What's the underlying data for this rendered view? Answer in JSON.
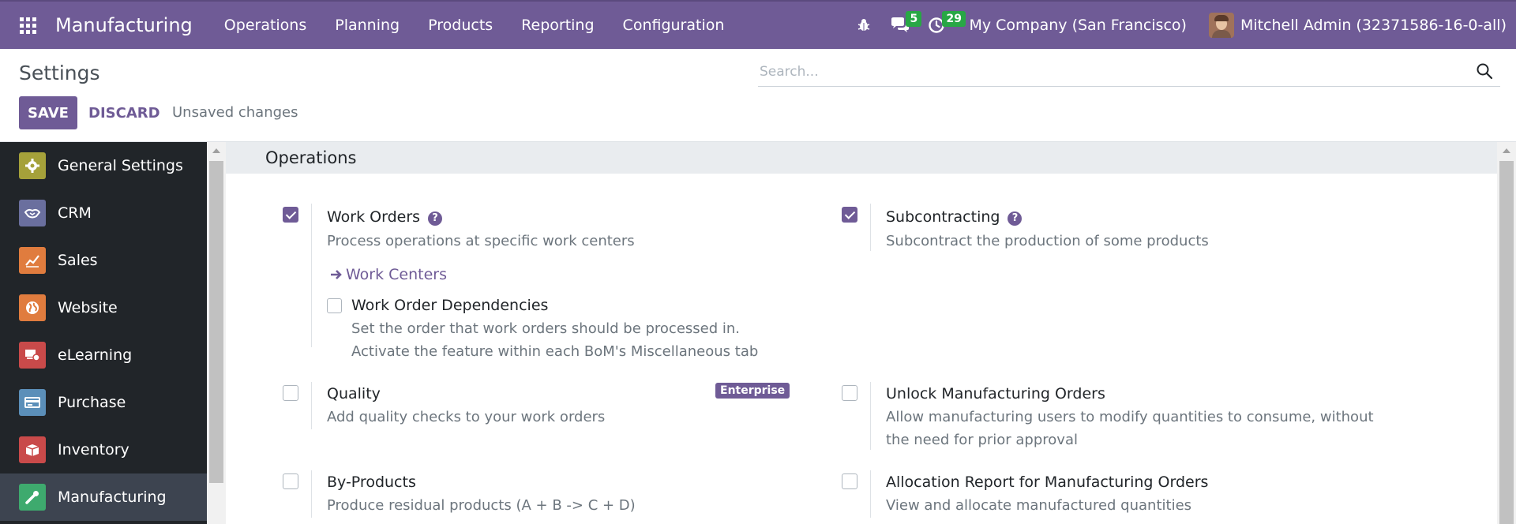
{
  "navbar": {
    "app_name": "Manufacturing",
    "menu": [
      "Operations",
      "Planning",
      "Products",
      "Reporting",
      "Configuration"
    ],
    "messages_count": "5",
    "activities_count": "29",
    "company": "My Company (San Francisco)",
    "user": "Mitchell Admin (32371586-16-0-all)"
  },
  "control_panel": {
    "title": "Settings",
    "search_placeholder": "Search...",
    "save_label": "SAVE",
    "discard_label": "DISCARD",
    "status": "Unsaved changes"
  },
  "sidebar": {
    "items": [
      {
        "label": "General Settings",
        "icon": "gear-icon",
        "color": "#a5a13a"
      },
      {
        "label": "CRM",
        "icon": "handshake-icon",
        "color": "#6a6f9e"
      },
      {
        "label": "Sales",
        "icon": "chart-icon",
        "color": "#e07c3e"
      },
      {
        "label": "Website",
        "icon": "globe-icon",
        "color": "#e07c3e"
      },
      {
        "label": "eLearning",
        "icon": "elearning-icon",
        "color": "#c94a4a"
      },
      {
        "label": "Purchase",
        "icon": "card-icon",
        "color": "#5b8fb9"
      },
      {
        "label": "Inventory",
        "icon": "box-icon",
        "color": "#c94a4a"
      },
      {
        "label": "Manufacturing",
        "icon": "wrench-icon",
        "color": "#3eaa6e"
      }
    ],
    "active_index": 7
  },
  "section": {
    "title": "Operations",
    "settings": {
      "work_orders": {
        "title": "Work Orders",
        "desc": "Process operations at specific work centers",
        "checked": true,
        "link": "Work Centers"
      },
      "work_order_dependencies": {
        "title": "Work Order Dependencies",
        "desc": "Set the order that work orders should be processed in. Activate the feature within each BoM's Miscellaneous tab",
        "checked": false
      },
      "subcontracting": {
        "title": "Subcontracting",
        "desc": "Subcontract the production of some products",
        "checked": true
      },
      "quality": {
        "title": "Quality",
        "desc": "Add quality checks to your work orders",
        "checked": false,
        "badge": "Enterprise"
      },
      "unlock_mo": {
        "title": "Unlock Manufacturing Orders",
        "desc": "Allow manufacturing users to modify quantities to consume, without the need for prior approval",
        "checked": false
      },
      "by_products": {
        "title": "By-Products",
        "desc": "Produce residual products (A + B -> C + D)",
        "checked": false
      },
      "allocation_report": {
        "title": "Allocation Report for Manufacturing Orders",
        "desc": "View and allocate manufactured quantities",
        "checked": false
      }
    }
  },
  "colors": {
    "brand": "#6f5b96",
    "sidebar_bg": "#212529"
  }
}
